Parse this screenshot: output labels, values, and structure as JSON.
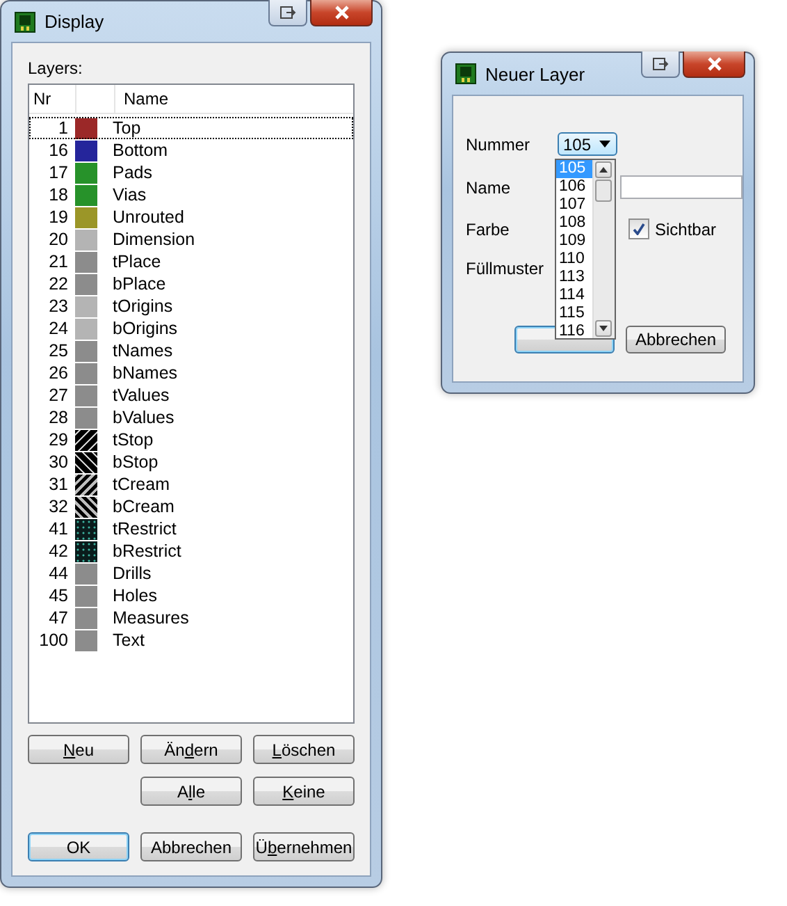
{
  "display_window": {
    "title": "Display",
    "layers_label": "Layers:",
    "columns": [
      "Nr",
      "Name"
    ],
    "layers": [
      {
        "nr": "1",
        "name": "Top",
        "color": "#9b2828",
        "kind": "solid",
        "selected": true
      },
      {
        "nr": "16",
        "name": "Bottom",
        "color": "#25259b",
        "kind": "solid",
        "selected": false
      },
      {
        "nr": "17",
        "name": "Pads",
        "color": "#27922a",
        "kind": "solid",
        "selected": false
      },
      {
        "nr": "18",
        "name": "Vias",
        "color": "#27922a",
        "kind": "solid",
        "selected": false
      },
      {
        "nr": "19",
        "name": "Unrouted",
        "color": "#9b9628",
        "kind": "solid",
        "selected": false
      },
      {
        "nr": "20",
        "name": "Dimension",
        "color": "#b4b4b4",
        "kind": "solid",
        "selected": false
      },
      {
        "nr": "21",
        "name": "tPlace",
        "color": "#8c8c8c",
        "kind": "solid",
        "selected": false
      },
      {
        "nr": "22",
        "name": "bPlace",
        "color": "#8c8c8c",
        "kind": "solid",
        "selected": false
      },
      {
        "nr": "23",
        "name": "tOrigins",
        "color": "#b4b4b4",
        "kind": "solid",
        "selected": false
      },
      {
        "nr": "24",
        "name": "bOrigins",
        "color": "#b4b4b4",
        "kind": "solid",
        "selected": false
      },
      {
        "nr": "25",
        "name": "tNames",
        "color": "#8c8c8c",
        "kind": "solid",
        "selected": false
      },
      {
        "nr": "26",
        "name": "bNames",
        "color": "#8c8c8c",
        "kind": "solid",
        "selected": false
      },
      {
        "nr": "27",
        "name": "tValues",
        "color": "#8c8c8c",
        "kind": "solid",
        "selected": false
      },
      {
        "nr": "28",
        "name": "bValues",
        "color": "#8c8c8c",
        "kind": "solid",
        "selected": false
      },
      {
        "nr": "29",
        "name": "tStop",
        "color": "#000000",
        "kind": "hatch-up",
        "selected": false
      },
      {
        "nr": "30",
        "name": "bStop",
        "color": "#000000",
        "kind": "hatch-down",
        "selected": false
      },
      {
        "nr": "31",
        "name": "tCream",
        "color": "#000000",
        "kind": "thick-up",
        "selected": false
      },
      {
        "nr": "32",
        "name": "bCream",
        "color": "#000000",
        "kind": "thick-down",
        "selected": false
      },
      {
        "nr": "41",
        "name": "tRestrict",
        "color": "#0a1c1c",
        "kind": "dots",
        "selected": false
      },
      {
        "nr": "42",
        "name": "bRestrict",
        "color": "#0a1c1c",
        "kind": "dots",
        "selected": false
      },
      {
        "nr": "44",
        "name": "Drills",
        "color": "#8c8c8c",
        "kind": "solid",
        "selected": false
      },
      {
        "nr": "45",
        "name": "Holes",
        "color": "#8c8c8c",
        "kind": "solid",
        "selected": false
      },
      {
        "nr": "47",
        "name": "Measures",
        "color": "#8c8c8c",
        "kind": "solid",
        "selected": false
      },
      {
        "nr": "100",
        "name": "Text",
        "color": "#8c8c8c",
        "kind": "solid",
        "selected": false
      }
    ],
    "edit_buttons": [
      {
        "access_key": "N",
        "text_after_key": "eu"
      },
      {
        "text_before_key": "Än",
        "access_key": "d",
        "text_after_key": "ern"
      },
      {
        "access_key": "L",
        "text_after_key": "öschen"
      }
    ],
    "select_buttons": [
      {
        "text_before_key": "A",
        "access_key": "l",
        "text_after_key": "le"
      },
      {
        "access_key": "K",
        "text_after_key": "eine"
      }
    ],
    "footer_buttons": [
      {
        "text_before_key": "OK",
        "default": true
      },
      {
        "text_before_key": "Abbrechen",
        "default": false
      },
      {
        "text_before_key": "Ü",
        "access_key": "b",
        "text_after_key": "ernehmen",
        "default": false
      }
    ]
  },
  "new_layer_window": {
    "title": "Neuer Layer",
    "number": {
      "label": "Nummer",
      "value": "105",
      "expanded": true,
      "options": [
        {
          "text": "105",
          "selected": true
        },
        {
          "text": "106",
          "selected": false
        },
        {
          "text": "107",
          "selected": false
        },
        {
          "text": "108",
          "selected": false
        },
        {
          "text": "109",
          "selected": false
        },
        {
          "text": "110",
          "selected": false
        },
        {
          "text": "113",
          "selected": false
        },
        {
          "text": "114",
          "selected": false
        },
        {
          "text": "115",
          "selected": false
        },
        {
          "text": "116",
          "selected": false
        }
      ]
    },
    "name": {
      "label": "Name"
    },
    "color": {
      "label": "Farbe"
    },
    "visible": {
      "label": "Sichtbar",
      "checked": true
    },
    "fill_pattern": {
      "label": "Füllmuster"
    },
    "cancel_button": {
      "label": "Abbrechen"
    }
  }
}
